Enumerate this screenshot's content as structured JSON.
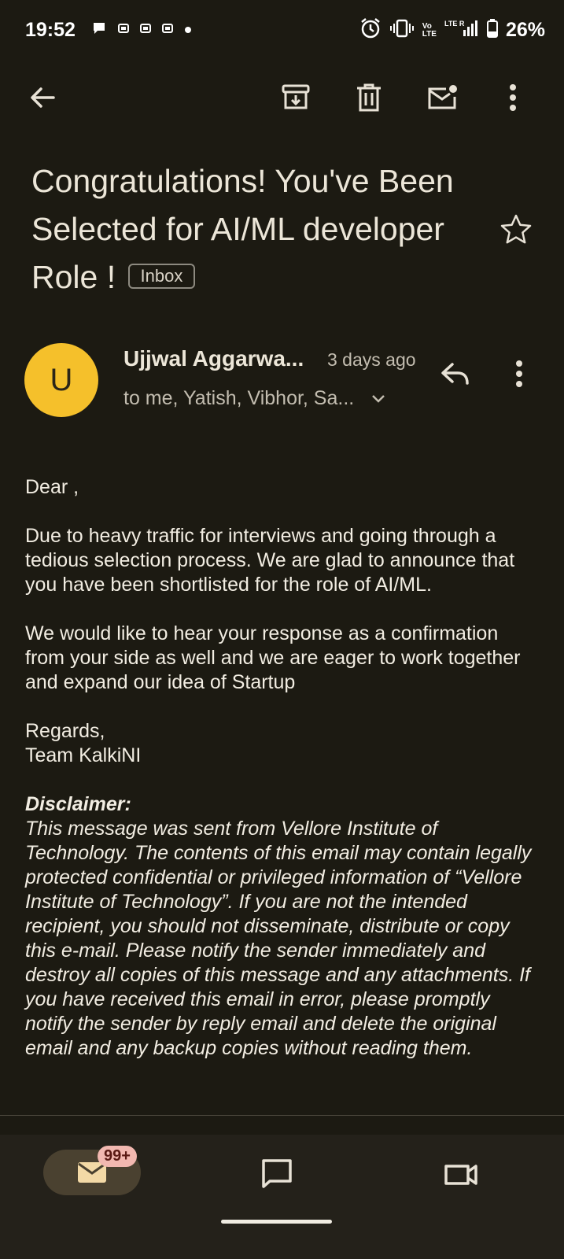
{
  "status_bar": {
    "time": "19:52",
    "battery": "26%",
    "network_vo": "Vo",
    "network_lte": "LTE",
    "network_lte2": "LTE R"
  },
  "toolbar": {
    "back_icon": "arrow-left-icon",
    "archive_icon": "archive-icon",
    "delete_icon": "trash-icon",
    "mark_unread_icon": "mark-unread-icon",
    "more_icon": "more-vert-icon"
  },
  "email": {
    "subject": "Congratulations! You've Been Selected for AI/ML developer Role !",
    "label": "Inbox",
    "sender_initial": "U",
    "sender_name": "Ujjwal Aggarwa...",
    "time": "3 days ago",
    "recipients": "to me, Yatish, Vibhor, Sa...",
    "body": {
      "greeting": "Dear ,",
      "para1": "Due to heavy traffic for interviews and going through a tedious selection process. We are glad to announce that you have been shortlisted for the role of AI/ML.",
      "para2": "We would like to hear your response as a confirmation from your side as well and we are eager to work together and expand our idea of Startup",
      "regards": "Regards,",
      "signature": "Team KalkiNI",
      "disclaimer_title": "Disclaimer:",
      "disclaimer_text": "This message was sent from Vellore Institute of Technology.  The contents of this email may contain legally protected confidential or privileged information of “Vellore Institute of Technology”.  If you are not the intended recipient, you should not disseminate, distribute or copy this e-mail. Please notify the sender immediately and destroy all copies of this message and any attachments. If you have received this email in error, please promptly notify the sender by reply email and delete the original email and any backup copies without reading them."
    }
  },
  "bottom_nav": {
    "mail_badge": "99+"
  },
  "colors": {
    "background": "#1c1a12",
    "avatar": "#f5c02b",
    "badge": "#f2b8b0"
  }
}
